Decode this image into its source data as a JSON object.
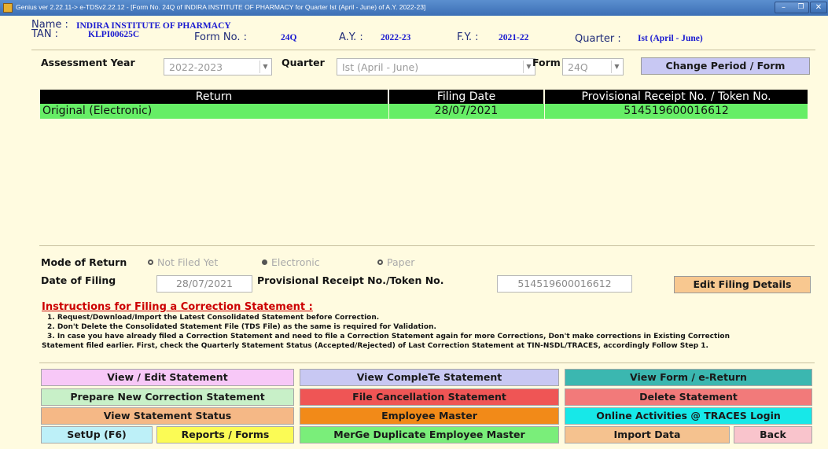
{
  "window": {
    "title": "Genius ver 2.22.11-> e-TDSv2.22.12 - [Form No. 24Q of INDIRA INSTITUTE OF PHARMACY for Quarter Ist (April - June) of A.Y. 2022-23]",
    "minimize": "–",
    "maximize": "❐",
    "close": "✕"
  },
  "header": {
    "name_label": "Name :",
    "name_value": "INDIRA INSTITUTE OF PHARMACY",
    "tan_label": "TAN :",
    "tan_value": "KLPI00625C",
    "form_label": "Form No. :",
    "form_value": "24Q",
    "ay_label": "A.Y. :",
    "ay_value": "2022-23",
    "fy_label": "F.Y. :",
    "fy_value": "2021-22",
    "quarter_label": "Quarter :",
    "quarter_value": "Ist (April - June)"
  },
  "period": {
    "ay_label": "Assessment Year",
    "ay_value": "2022-2023",
    "quarter_label": "Quarter",
    "quarter_value": "Ist (April - June)",
    "form_label": "Form",
    "form_value": "24Q",
    "change_button": "Change Period / Form"
  },
  "returns_table": {
    "columns": [
      "Return",
      "Filing Date",
      "Provisional Receipt No. / Token No."
    ],
    "rows": [
      {
        "return": "Original (Electronic)",
        "filing_date": "28/07/2021",
        "token": "514519600016612"
      }
    ]
  },
  "filing": {
    "mode_label": "Mode of Return",
    "options": [
      "Not Filed Yet",
      "Electronic",
      "Paper"
    ],
    "date_label": "Date of Filing",
    "date_value": "28/07/2021",
    "token_label": "Provisional Receipt No./Token No.",
    "token_value": "514519600016612",
    "edit_button": "Edit Filing Details"
  },
  "instructions": {
    "title": "Instructions for Filing a Correction Statement :",
    "lines": [
      "1. Request/Download/Import the Latest Consolidated Statement before Correction.",
      "2. Don't Delete the Consolidated Statement File (TDS File) as the same is required for Validation.",
      "3. In case you have already filed a Correction Statement and need to file a Correction Statement again for more Corrections, Don't make corrections in Existing Correction",
      "Statement filed earlier. First, check the Quarterly Statement Status (Accepted/Rejected) of Last Correction Statement at TIN-NSDL/TRACES, accordingly Follow Step 1."
    ]
  },
  "buttons": {
    "view_edit": "View / Edit Statement",
    "view_complete": "View CompleTe Statement",
    "view_form": "View Form / e-Return",
    "prepare_correction": "Prepare New Correction Statement",
    "file_cancellation": "File Cancellation Statement",
    "delete_statement": "Delete Statement",
    "view_status": "View Statement Status",
    "employee_master": "Employee Master",
    "online_activities": "Online Activities @ TRACES Login",
    "setup": "SetUp (F6)",
    "reports": "Reports / Forms",
    "merge_duplicate": "MerGe Duplicate Employee Master",
    "import_data": "Import Data",
    "back": "Back"
  },
  "colors": {
    "view_edit": "#f7c8f7",
    "view_complete": "#c8c8f3",
    "view_form": "#3bb7b0",
    "prepare_correction": "#c8f0c8",
    "file_cancellation": "#ef5555",
    "delete_statement": "#f27a7a",
    "view_status": "#f5b886",
    "employee_master": "#f28a18",
    "online_activities": "#17e8e8",
    "setup": "#bdf0f8",
    "reports": "#fbfb55",
    "merge_duplicate": "#7aee7a",
    "import_data": "#f5c28f",
    "back": "#f9c4cc",
    "change_period": "#c8c8f3",
    "edit_filing": "#f8c890",
    "row_highlight": "#66ee66"
  }
}
